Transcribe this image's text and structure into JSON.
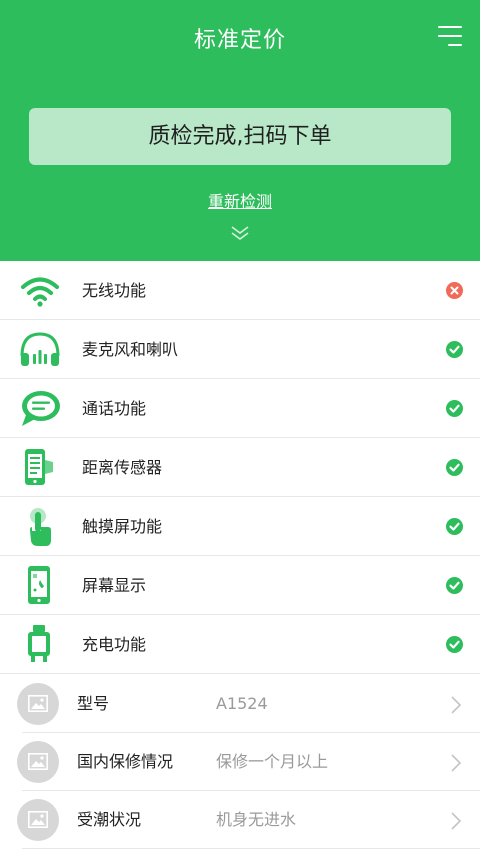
{
  "header": {
    "title": "标准定价",
    "menu_icon": "hamburger-menu-icon",
    "order_button": "质检完成,扫码下单",
    "recheck_link": "重新检测",
    "expand_icon": "double-chevron-down-icon"
  },
  "colors": {
    "brand_green": "#2ebd5c",
    "button_light_green": "#b9e8c9",
    "pass_green": "#2ebd5c",
    "fail_red": "#f06a5a"
  },
  "checks": [
    {
      "label": "无线功能",
      "icon": "wifi-icon",
      "status": "fail"
    },
    {
      "label": "麦克风和喇叭",
      "icon": "headphones-icon",
      "status": "pass"
    },
    {
      "label": "通话功能",
      "icon": "chat-bubble-icon",
      "status": "pass"
    },
    {
      "label": "距离传感器",
      "icon": "proximity-sensor-icon",
      "status": "pass"
    },
    {
      "label": "触摸屏功能",
      "icon": "touch-hand-icon",
      "status": "pass"
    },
    {
      "label": "屏幕显示",
      "icon": "phone-screen-icon",
      "status": "pass"
    },
    {
      "label": "充电功能",
      "icon": "charger-icon",
      "status": "pass"
    }
  ],
  "info": [
    {
      "key": "型号",
      "value": "A1524"
    },
    {
      "key": "国内保修情况",
      "value": "保修一个月以上"
    },
    {
      "key": "受潮状况",
      "value": "机身无进水"
    }
  ]
}
